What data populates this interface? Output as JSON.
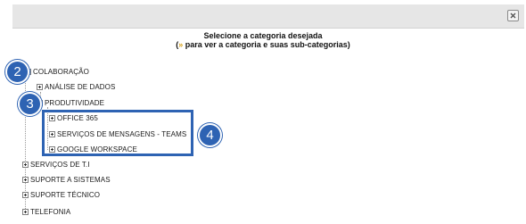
{
  "dialog": {
    "instruction_title": "Selecione a categoria desejada",
    "instruction_open": "(",
    "instruction_chevron": "»",
    "instruction_hint": " para ver a categoria e suas sub-categorias)",
    "close_icon": "close-icon"
  },
  "tree": {
    "colaboracao": "COLABORAÇÃO",
    "analise": "ANÁLISE DE DADOS",
    "produtividade": "PRODUTIVIDADE",
    "office": "OFFICE 365",
    "mensagens": "SERVIÇOS DE MENSAGENS - TEAMS",
    "google": "GOOGLE WORKSPACE",
    "servicos_ti": "SERVIÇOS DE T.I",
    "suporte_sistemas": "SUPORTE A SISTEMAS",
    "suporte_tecnico": "SUPORTE TÉCNICO",
    "telefonia": "TELEFONIA"
  },
  "annotations": {
    "step_2": "2",
    "step_3": "3",
    "step_4": "4",
    "color": "#2e63b3"
  }
}
